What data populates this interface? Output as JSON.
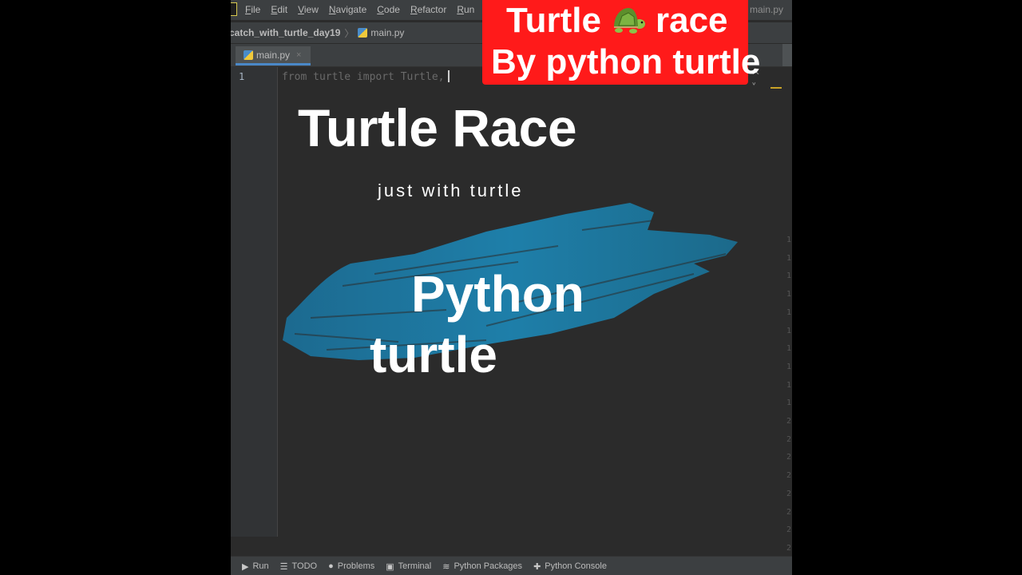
{
  "menu": {
    "items": [
      "File",
      "Edit",
      "View",
      "Navigate",
      "Code",
      "Refactor",
      "Run"
    ],
    "title_file": "main.py"
  },
  "breadcrumb": {
    "project": "catch_with_turtle_day19",
    "file": "main.py"
  },
  "tabs": [
    {
      "label": "main.py",
      "close": "×"
    }
  ],
  "editor": {
    "line_number": "1",
    "code": "from turtle import Turtle,",
    "nav_arrows": "^ ˅",
    "stripe_digits": "1\n1\n1\n1\n1\n1\n1\n1\n1\n1\n2\n2\n2\n2\n2\n2\n2\n2"
  },
  "overlay": {
    "title": "Turtle Race",
    "subtitle": "just with turtle",
    "python": "Python",
    "turtle": "turtle"
  },
  "banner": {
    "line1_before": "Turtle",
    "line1_after": "race",
    "line2": "By python turtle",
    "icon": "turtle-icon"
  },
  "toolbar": {
    "buttons": [
      {
        "label": "Run",
        "icon": "play-icon"
      },
      {
        "label": "TODO",
        "icon": "list-icon"
      },
      {
        "label": "Problems",
        "icon": "info-icon"
      },
      {
        "label": "Terminal",
        "icon": "terminal-icon"
      },
      {
        "label": "Python Packages",
        "icon": "layers-icon"
      },
      {
        "label": "Python Console",
        "icon": "python-icon"
      }
    ]
  },
  "colors": {
    "ide_bg": "#2b2b2b",
    "banner": "#ff1a1a",
    "brush": "#1f7fa6"
  }
}
